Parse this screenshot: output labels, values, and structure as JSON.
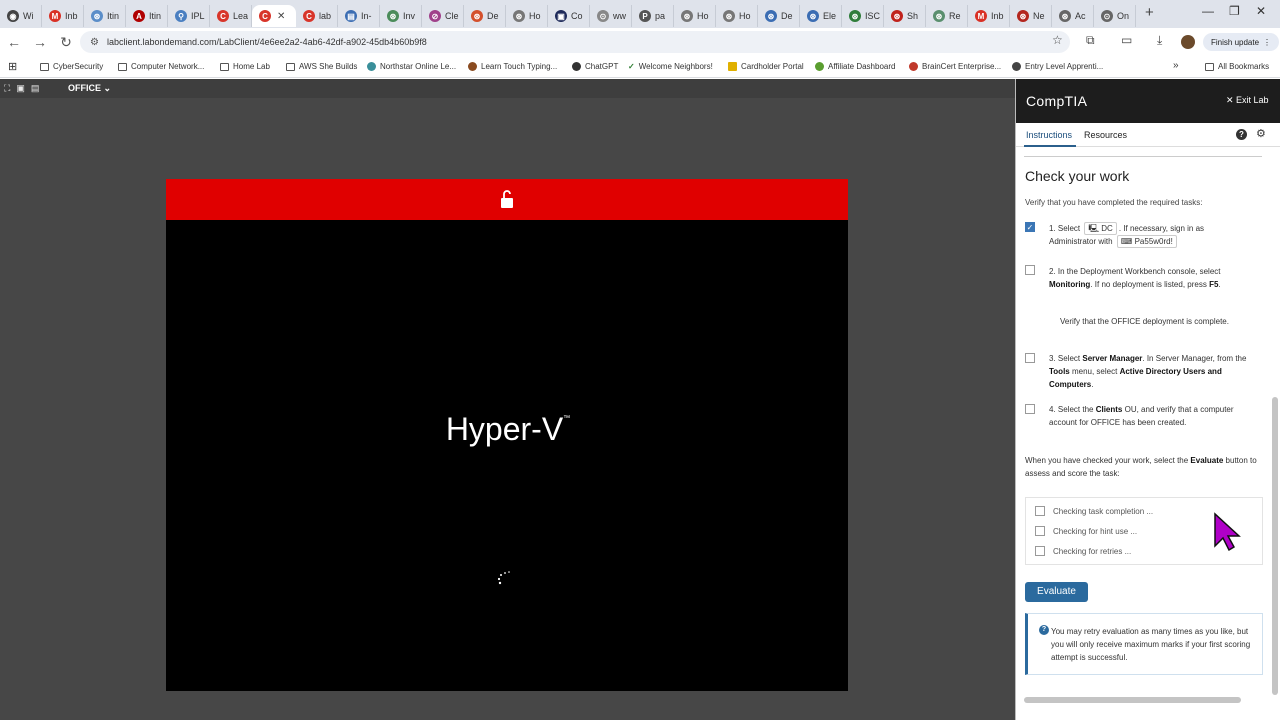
{
  "browser": {
    "tabs": [
      {
        "title": "Wi",
        "color": "#444444",
        "glyph": "◉"
      },
      {
        "title": "Inb",
        "color": "#d93025",
        "glyph": "M"
      },
      {
        "title": "Itin",
        "color": "#5b8ec9",
        "glyph": "⊛"
      },
      {
        "title": "Itin",
        "color": "#b00000",
        "glyph": "A"
      },
      {
        "title": "IPL",
        "color": "#4a7fc1",
        "glyph": "⚲"
      },
      {
        "title": "Lea",
        "color": "#d8352a",
        "glyph": "C"
      },
      {
        "title": "",
        "color": "#d8352a",
        "glyph": "C"
      },
      {
        "title": "lab",
        "color": "#d8352a",
        "glyph": "C"
      },
      {
        "title": "In-",
        "color": "#3b6db3",
        "glyph": "▤"
      },
      {
        "title": "Inv",
        "color": "#4b8c5a",
        "glyph": "⊛"
      },
      {
        "title": "Cle",
        "color": "#a0418a",
        "glyph": "⊘"
      },
      {
        "title": "De",
        "color": "#d4502c",
        "glyph": "⊛"
      },
      {
        "title": "Ho",
        "color": "#777777",
        "glyph": "⊛"
      },
      {
        "title": "Co",
        "color": "#1e2a5a",
        "glyph": "▣"
      },
      {
        "title": "ww",
        "color": "#888888",
        "glyph": "⊙"
      },
      {
        "title": "pa",
        "color": "#555555",
        "glyph": "P"
      },
      {
        "title": "Ho",
        "color": "#777777",
        "glyph": "⊛"
      },
      {
        "title": "Ho",
        "color": "#777777",
        "glyph": "⊛"
      },
      {
        "title": "De",
        "color": "#3b6db3",
        "glyph": "⊛"
      },
      {
        "title": "Ele",
        "color": "#3b6db3",
        "glyph": "⊛"
      },
      {
        "title": "ISC",
        "color": "#2f7d3a",
        "glyph": "⊛"
      },
      {
        "title": "Sh",
        "color": "#c0221c",
        "glyph": "⊛"
      },
      {
        "title": "Re",
        "color": "#5a8f6e",
        "glyph": "⊛"
      },
      {
        "title": "Inb",
        "color": "#d93025",
        "glyph": "M"
      },
      {
        "title": "Ne",
        "color": "#b3261e",
        "glyph": "⊛"
      },
      {
        "title": "Ac",
        "color": "#666666",
        "glyph": "⊛"
      },
      {
        "title": "On",
        "color": "#666666",
        "glyph": "⊙"
      }
    ],
    "url": "labclient.labondemand.com/LabClient/4e6ee2a2-4ab6-42df-a902-45db4b60b9f8",
    "finish_update": "Finish update",
    "bookmarks": [
      "CyberSecurity",
      "Computer Network...",
      "Home Lab",
      "AWS She Builds",
      "Northstar Online Le...",
      "Learn Touch Typing...",
      "ChatGPT",
      "Welcome Neighbors!",
      "Cardholder Portal",
      "Affiliate Dashboard",
      "BrainCert Enterprise...",
      "Entry Level Apprenti..."
    ],
    "all_bookmarks": "All Bookmarks"
  },
  "lab": {
    "vm_selector": "OFFICE",
    "vm_splash": "Hyper-V",
    "trademark": "™",
    "colors": {
      "banner": "#e00000",
      "accent": "#2b6a9e"
    }
  },
  "panel": {
    "brand": "CompTIA",
    "exit_label": "Exit Lab",
    "tab_instructions": "Instructions",
    "tab_resources": "Resources",
    "heading": "Check your work",
    "intro": "Verify that you have completed the required tasks:",
    "steps": [
      {
        "checked": true,
        "a": "1. Select ",
        "chip1": "DC",
        "b": ". If necessary, sign in as Administrator with ",
        "chip2": "Pa55w0rd!"
      },
      {
        "checked": false,
        "a": "2. In the Deployment Workbench console, select ",
        "bold1": "Monitoring",
        "b": ". If no deployment is listed, press ",
        "bold2": "F5",
        "c": ".",
        "note": "Verify that the OFFICE deployment is complete."
      },
      {
        "checked": false,
        "a": "3. Select ",
        "bold1": "Server Manager",
        "b": ". In Server Manager, from the ",
        "bold2": "Tools",
        "c": " menu, select ",
        "bold3": "Active Directory Users and Computers",
        "d": "."
      },
      {
        "checked": false,
        "a": "4. Select the ",
        "bold1": "Clients",
        "b": " OU, and verify that a computer account for OFFICE has been created."
      }
    ],
    "when_text": "When you have checked your work, select the ",
    "when_bold": "Evaluate",
    "when_tail": " button to assess and score the task:",
    "eval_items": [
      "Checking task completion ...",
      "Checking for hint use ...",
      "Checking for retries ..."
    ],
    "evaluate_button": "Evaluate",
    "retry_note": "You may retry evaluation as many times as you like, but you will only receive maximum marks if your first scoring attempt is successful."
  }
}
